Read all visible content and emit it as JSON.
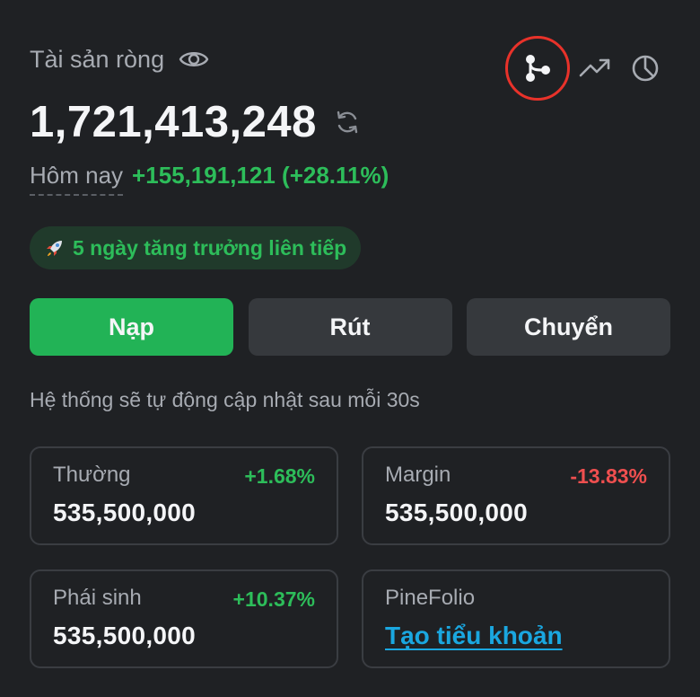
{
  "header": {
    "net_assets_label": "Tài sản ròng",
    "icons": [
      "eye-icon",
      "branch-icon",
      "trend-up-icon",
      "pie-chart-icon"
    ]
  },
  "total": {
    "value": "1,721,413,248",
    "refresh_icon": "refresh-icon"
  },
  "today": {
    "label": "Hôm nay",
    "change": "+155,191,121 (+28.11%)"
  },
  "streak": {
    "icon": "rocket-icon",
    "text": "5 ngày tăng trưởng liên tiếp"
  },
  "actions": {
    "deposit": "Nạp",
    "withdraw": "Rút",
    "transfer": "Chuyển"
  },
  "notice": "Hệ thống sẽ tự động cập nhật sau mỗi 30s",
  "cards": [
    {
      "title": "Thường",
      "change": "+1.68%",
      "value": "535,500,000"
    },
    {
      "title": "Margin",
      "change": "-13.83%",
      "value": "535,500,000"
    },
    {
      "title": "Phái sinh",
      "change": "+10.37%",
      "value": "535,500,000"
    },
    {
      "title": "PineFolio",
      "link": "Tạo tiểu khoản"
    }
  ],
  "colors": {
    "background": "#1f2124",
    "positive": "#2dbd5a",
    "negative": "#ef4f4f",
    "primary_button": "#22b356",
    "link": "#1aa7e0",
    "highlight_ring": "#e8322a"
  }
}
